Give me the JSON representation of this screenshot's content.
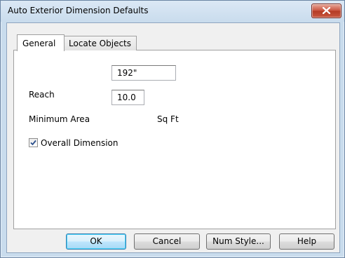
{
  "window": {
    "title": "Auto Exterior Dimension Defaults"
  },
  "tabs": [
    {
      "label": "General",
      "selected": true
    },
    {
      "label": "Locate Objects",
      "selected": false
    }
  ],
  "general": {
    "reach_label": "Reach",
    "reach_value": "192\"",
    "min_area_label": "Minimum Area",
    "min_area_value": "10.0",
    "min_area_unit": "Sq Ft",
    "overall_dimension_label": "Overall Dimension",
    "overall_dimension_checked": true
  },
  "buttons": {
    "ok": "OK",
    "cancel": "Cancel",
    "num_style": "Num Style...",
    "help": "Help"
  },
  "icons": {
    "close": "close-x-icon",
    "checkmark": "checkmark-icon"
  },
  "colors": {
    "frame": "#c9dced",
    "close_button": "#c9513c",
    "default_button_border": "#3c7fb1"
  }
}
